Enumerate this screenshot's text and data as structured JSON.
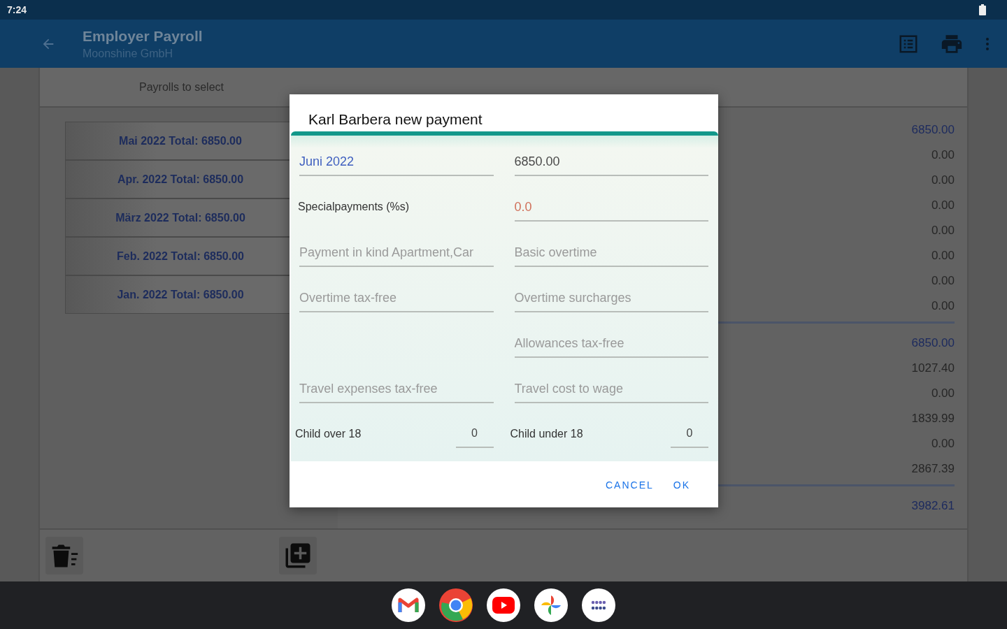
{
  "status_bar": {
    "time": "7:24"
  },
  "app_bar": {
    "title": "Employer Payroll",
    "subtitle": "Moonshine GmbH"
  },
  "left_panel": {
    "heading": "Payrolls to select",
    "payrolls": [
      {
        "label": "Mai 2022 Total: 6850.00"
      },
      {
        "label": "Apr. 2022 Total: 6850.00"
      },
      {
        "label": "März 2022 Total: 6850.00"
      },
      {
        "label": "Feb. 2022 Total: 6850.00"
      },
      {
        "label": "Jan. 2022 Total: 6850.00"
      }
    ]
  },
  "amounts": [
    [
      {
        "text": "6850.00",
        "kind": "total"
      },
      {
        "text": "0.00",
        "kind": "amount"
      },
      {
        "text": "0.00",
        "kind": "amount"
      },
      {
        "text": "0.00",
        "kind": "amount"
      },
      {
        "text": "0.00",
        "kind": "amount"
      },
      {
        "text": "0.00",
        "kind": "amount"
      },
      {
        "text": "0.00",
        "kind": "amount"
      },
      {
        "text": "0.00",
        "kind": "amount"
      }
    ],
    [
      {
        "text": "6850.00",
        "kind": "total"
      },
      {
        "text": "1027.40",
        "kind": "amount"
      },
      {
        "text": "0.00",
        "kind": "amount"
      },
      {
        "text": "1839.99",
        "kind": "amount"
      },
      {
        "text": "0.00",
        "kind": "amount"
      },
      {
        "text": "2867.39",
        "kind": "amount"
      }
    ],
    [
      {
        "text": "3982.61",
        "kind": "total"
      }
    ]
  ],
  "dialog": {
    "title": "Karl Barbera new payment",
    "rows": [
      [
        {
          "kind": "field",
          "value": "Juni 2022",
          "color": "#3f5fbf"
        },
        {
          "kind": "field",
          "value": "6850.00",
          "color": "#4a4a4a"
        }
      ],
      [
        {
          "kind": "label",
          "text": "Specialpayments (%s)"
        },
        {
          "kind": "field",
          "value": "0.0",
          "color": "#d0705a"
        }
      ],
      [
        {
          "kind": "field",
          "placeholder": "Payment in kind Apartment,Car"
        },
        {
          "kind": "field",
          "placeholder": "Basic overtime"
        }
      ],
      [
        {
          "kind": "field",
          "placeholder": "Overtime tax-free"
        },
        {
          "kind": "field",
          "placeholder": "Overtime surcharges"
        }
      ],
      [
        {
          "kind": "blank"
        },
        {
          "kind": "field",
          "placeholder": "Allowances tax-free"
        }
      ],
      [
        {
          "kind": "field",
          "placeholder": "Travel expenses tax-free"
        },
        {
          "kind": "field",
          "placeholder": "Travel cost to wage"
        }
      ],
      [
        {
          "kind": "counter",
          "label": "Child over 18",
          "value": "0"
        },
        {
          "kind": "counter",
          "label": "Child under 18",
          "value": "0"
        }
      ]
    ],
    "buttons": [
      "CANCEL",
      "OK"
    ]
  }
}
